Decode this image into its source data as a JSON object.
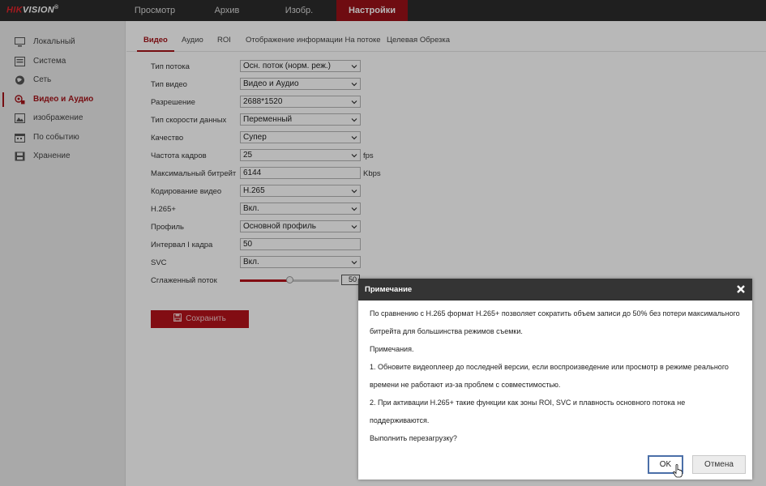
{
  "brand": {
    "part1": "HIK",
    "part2": "VISION",
    "reg": "®"
  },
  "topnav": [
    "Просмотр",
    "Архив",
    "Изобр.",
    "Настройки"
  ],
  "sidebar": [
    {
      "label": "Локальный",
      "icon": "monitor-icon"
    },
    {
      "label": "Система",
      "icon": "system-icon"
    },
    {
      "label": "Сеть",
      "icon": "globe-icon"
    },
    {
      "label": "Видео и Аудио",
      "icon": "video-audio-icon"
    },
    {
      "label": "изображение",
      "icon": "image-icon"
    },
    {
      "label": "По событию",
      "icon": "calendar-icon"
    },
    {
      "label": "Хранение",
      "icon": "storage-icon"
    }
  ],
  "tabs": [
    "Видео",
    "Аудио",
    "ROI",
    "Отображение информации На потоке",
    "Целевая Обрезка"
  ],
  "form": {
    "stream_type": {
      "label": "Тип потока",
      "value": "Осн. поток (норм. реж.)"
    },
    "video_type": {
      "label": "Тип видео",
      "value": "Видео и Аудио"
    },
    "resolution": {
      "label": "Разрешение",
      "value": "2688*1520"
    },
    "bitrate_type": {
      "label": "Тип скорости данных",
      "value": "Переменный"
    },
    "quality": {
      "label": "Качество",
      "value": "Супер"
    },
    "frame_rate": {
      "label": "Частота кадров",
      "value": "25",
      "unit": "fps"
    },
    "max_bitrate": {
      "label": "Максимальный битрейт",
      "value": "6144",
      "unit": "Kbps"
    },
    "encoding": {
      "label": "Кодирование видео",
      "value": "H.265"
    },
    "h265plus": {
      "label": "H.265+",
      "value": "Вкл."
    },
    "profile": {
      "label": "Профиль",
      "value": "Основной профиль"
    },
    "i_frame": {
      "label": "Интервал I кадра",
      "value": "50"
    },
    "svc": {
      "label": "SVC",
      "value": "Вкл."
    },
    "smoothing": {
      "label": "Сглаженный поток",
      "value": "50"
    }
  },
  "save_label": "Сохранить",
  "dialog": {
    "title": "Примечание",
    "lines": [
      "По сравнению с H.265 формат H.265+ позволяет сократить объем записи до 50% без потери максимального",
      "битрейта для большинства режимов съемки.",
      "Примечания.",
      "1. Обновите видеоплеер до последней версии, если воспроизведение или просмотр в режиме реального",
      "времени не работают из-за проблем с совместимостью.",
      "2. При активации H.265+ такие функции как зоны ROI, SVC и плавность основного потока не",
      "поддерживаются.",
      "Выполнить перезагрузку?"
    ],
    "ok_label": "OK",
    "cancel_label": "Отмена"
  },
  "colors": {
    "accent": "#b5121b",
    "topbar": "#2b2b2b",
    "dialog_header": "#343434"
  }
}
